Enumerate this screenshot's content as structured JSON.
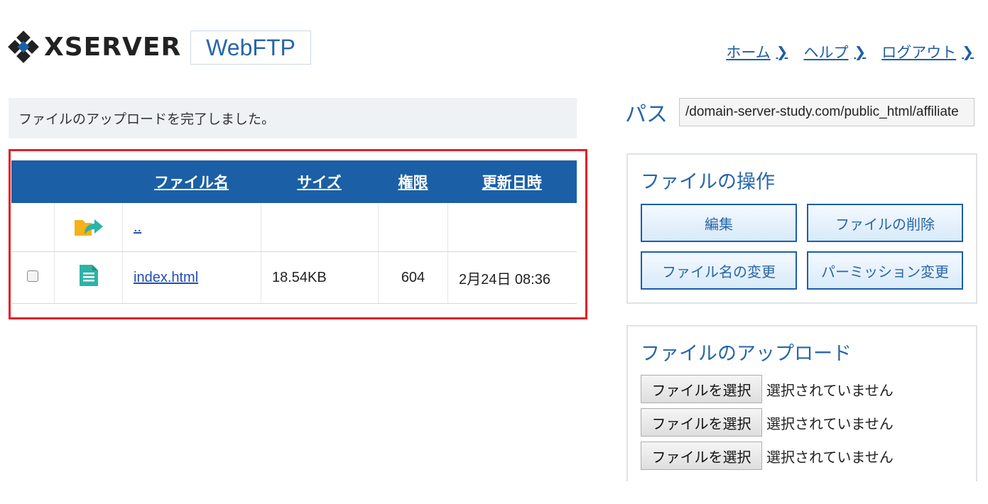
{
  "header": {
    "brand": "XSERVER",
    "product_badge": "WebFTP",
    "nav": [
      {
        "label": "ホーム"
      },
      {
        "label": "ヘルプ"
      },
      {
        "label": "ログアウト"
      }
    ]
  },
  "notice": "ファイルのアップロードを完了しました。",
  "file_table": {
    "columns": [
      "ファイル名",
      "サイズ",
      "権限",
      "更新日時"
    ],
    "rows": [
      {
        "name": "..",
        "size": "",
        "permission": "",
        "modified": "",
        "icon": "parent-folder-icon"
      },
      {
        "name": "index.html",
        "size": "18.54KB",
        "permission": "604",
        "modified": "2月24日 08:36",
        "icon": "html-file-icon"
      }
    ]
  },
  "path": {
    "label": "パス",
    "value": "/domain-server-study.com/public_html/affiliate"
  },
  "file_ops": {
    "title": "ファイルの操作",
    "buttons": [
      "編集",
      "ファイルの削除",
      "ファイル名の変更",
      "パーミッション変更"
    ]
  },
  "upload": {
    "title": "ファイルのアップロード",
    "pickers": [
      {
        "button": "ファイルを選択",
        "status": "選択されていません"
      },
      {
        "button": "ファイルを選択",
        "status": "選択されていません"
      },
      {
        "button": "ファイルを選択",
        "status": "選択されていません"
      }
    ]
  },
  "colors": {
    "accent": "#1b5fa6",
    "highlight_border": "#e0202a",
    "link": "#1f5ea5"
  }
}
